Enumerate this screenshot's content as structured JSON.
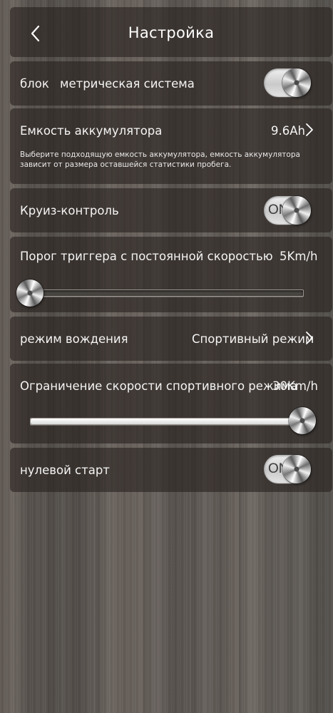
{
  "header": {
    "title": "Настройка",
    "back_icon": "chevron-left-icon"
  },
  "rows": {
    "units": {
      "label": "блок",
      "value": "метрическая система",
      "toggle_on": true
    },
    "battery": {
      "label": "Емкость аккумулятора",
      "value": "9.6Ah",
      "note": "Выберите подходящую емкость аккумулятора, емкость аккумулятора зависит от размера оставшейся статистики пробега."
    },
    "cruise": {
      "label": "Круиз-контроль",
      "toggle_text": "ON",
      "toggle_on": true
    },
    "trigger": {
      "label": "Порог триггера с постоянной скоростью",
      "value": "5Km/h",
      "level": 0.0
    },
    "drive_mode": {
      "label": "режим вождения",
      "value": "Спортивный режим"
    },
    "sport_limit": {
      "label": "Ограничение скорости спортивного режима",
      "value": "30Km/h",
      "level": 1.0
    },
    "zero_start": {
      "label": "нулевой старт",
      "toggle_text": "ON",
      "toggle_on": true
    }
  }
}
